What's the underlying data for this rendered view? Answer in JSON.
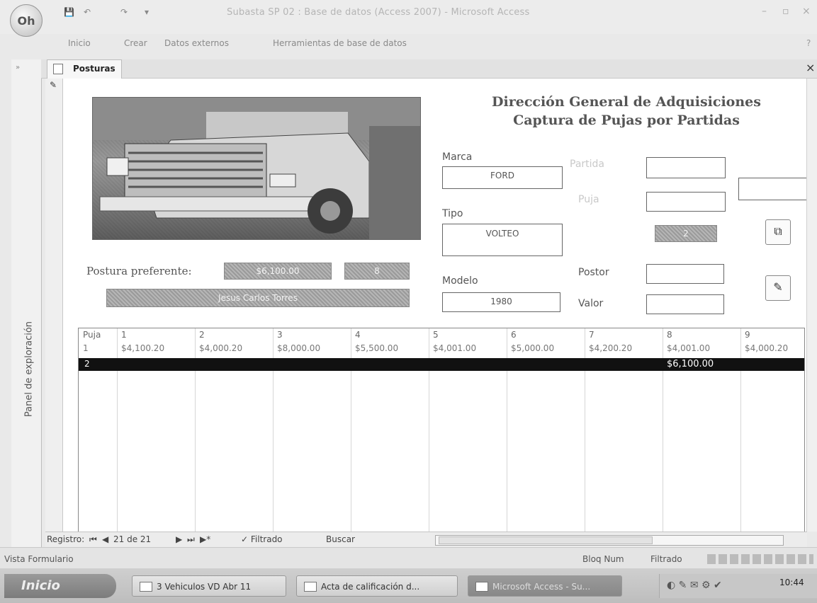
{
  "window": {
    "title": "Subasta SP 02 : Base de datos (Access 2007) - Microsoft Access",
    "office_button": "Oh",
    "controls": {
      "minimize": "–",
      "restore": "▫",
      "close": "×"
    }
  },
  "ribbon": {
    "tabs": [
      "Inicio",
      "Crear",
      "Datos externos",
      "Herramientas de base de datos"
    ]
  },
  "nav_pane": {
    "label": "Panel de exploración",
    "toggle": "»"
  },
  "document_tab": {
    "label": "Posturas",
    "close": "×"
  },
  "form": {
    "heading_line1": "Dirección General de Adquisiciones",
    "heading_line2": "Captura de Pujas por Partidas",
    "marca_label": "Marca",
    "marca_value": "FORD",
    "tipo_label": "Tipo",
    "tipo_value": "VOLTEO",
    "modelo_label": "Modelo",
    "modelo_value": "1980",
    "partida_label": "Partida",
    "puja_label": "Puja",
    "counter_value": "2",
    "postor_label": "Postor",
    "valor_label": "Valor",
    "postura_label": "Postura preferente:",
    "postura_value": "$6,100.00",
    "postura_code": "8",
    "postor_name": "Jesus Carlos Torres"
  },
  "grid": {
    "columns": [
      "Puja",
      "1",
      "2",
      "3",
      "4",
      "5",
      "6",
      "7",
      "8",
      "9"
    ],
    "row1": [
      "1",
      "$4,100.20",
      "$4,000.20",
      "$8,000.00",
      "$5,500.00",
      "$4,001.00",
      "$5,000.00",
      "$4,200.20",
      "$4,001.00",
      "$4,000.20"
    ],
    "row2_num": "2",
    "row2_col8": "$6,100.00"
  },
  "record_nav": {
    "label": "Registro:",
    "position": "21 de 21",
    "filter": "Filtrado",
    "search": "Buscar"
  },
  "status_bar": {
    "view": "Vista Formulario",
    "numlock": "Bloq Num",
    "filter": "Filtrado"
  },
  "taskbar": {
    "start": "Inicio",
    "tasks": [
      "3 Vehiculos VD Abr 11",
      "Acta de calificación d...",
      "Microsoft Access - Su..."
    ],
    "clock": "10:44"
  }
}
